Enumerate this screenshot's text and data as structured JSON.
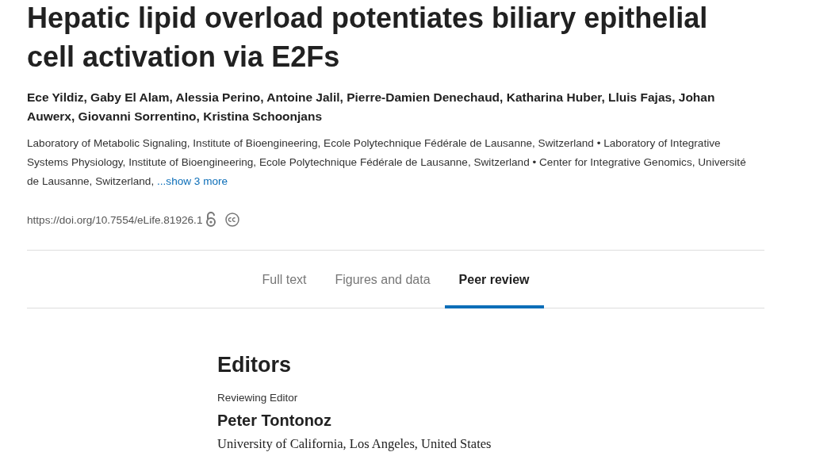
{
  "article": {
    "title": "Hepatic lipid overload potentiates biliary epithelial cell activation via E2Fs",
    "authors": "Ece Yildiz, Gaby El Alam, Alessia Perino, Antoine Jalil, Pierre-Damien Denechaud, Katharina Huber, Lluis Fajas, Johan Auwerx, Giovanni Sorrentino, Kristina Schoonjans",
    "affiliations": "Laboratory of Metabolic Signaling, Institute of Bioengineering, Ecole Polytechnique Fédérale de Lausanne, Switzerland • Laboratory of Integrative Systems Physiology, Institute of Bioengineering, Ecole Polytechnique Fédérale de Lausanne, Switzerland • Center for Integrative Genomics, Université de Lausanne, Switzerland,",
    "show_more": "...show 3 more",
    "doi": "https://doi.org/10.7554/eLife.81926.1"
  },
  "tabs": [
    {
      "label": "Full text",
      "selected": false
    },
    {
      "label": "Figures and data",
      "selected": false
    },
    {
      "label": "Peer review",
      "selected": true
    }
  ],
  "editors": {
    "heading": "Editors",
    "role": "Reviewing Editor",
    "name": "Peter Tontonoz",
    "affiliation": "University of California, Los Angeles, United States"
  }
}
